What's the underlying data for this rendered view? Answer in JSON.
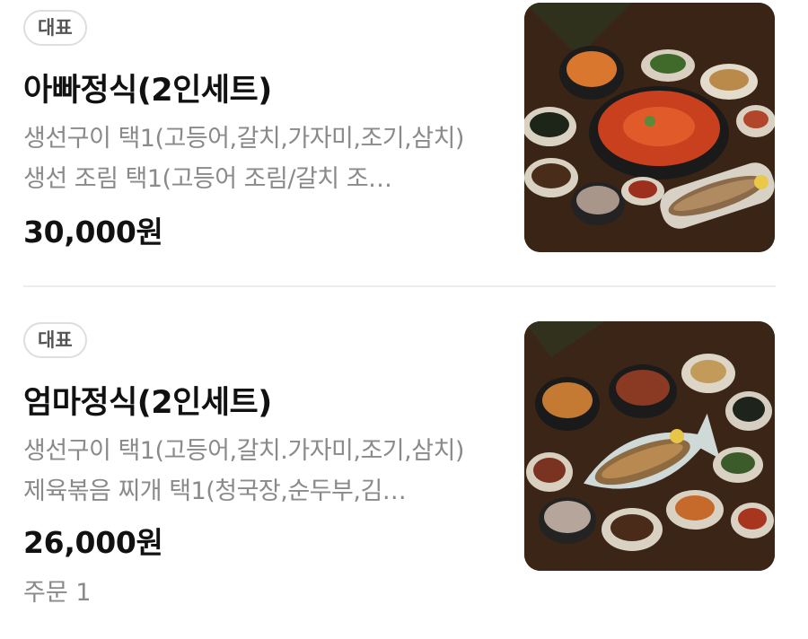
{
  "menu": {
    "items": [
      {
        "badge": "대표",
        "title": "아빠정식(2인세트)",
        "description": "생선구이 택1(고등어,갈치,가자미,조기,삼치) 생선 조림 택1(고등어 조림/갈치 조…",
        "price": "30,000원",
        "image_icon": "korean-set-meal-photo"
      },
      {
        "badge": "대표",
        "title": "엄마정식(2인세트)",
        "description": "생선구이 택1(고등어,갈치.가자미,조기,삼치) 제육볶음 찌개 택1(청국장,순두부,김…",
        "price": "26,000원",
        "order_count": "주문 1",
        "image_icon": "korean-set-meal-photo"
      }
    ]
  }
}
